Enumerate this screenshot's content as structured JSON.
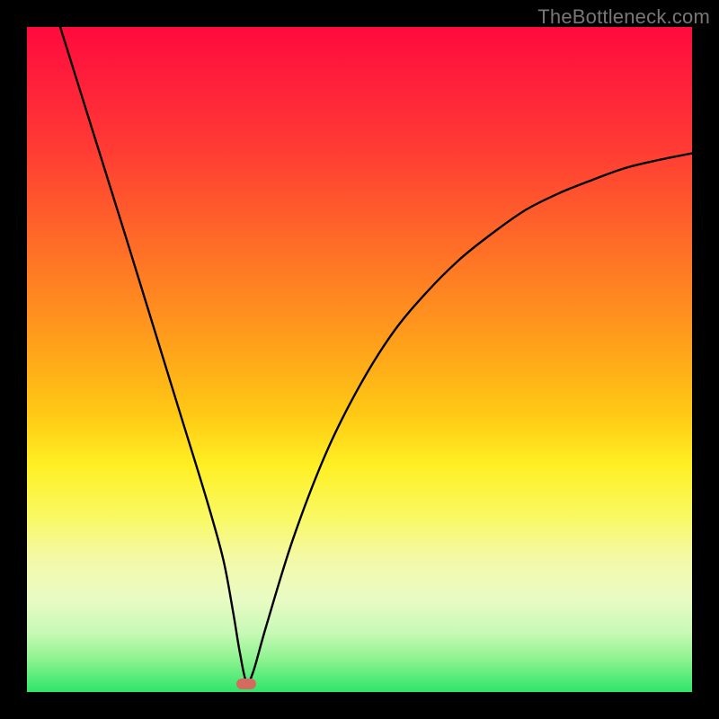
{
  "attribution": "TheBottleneck.com",
  "colors": {
    "bg": "#000000",
    "top": "#ff0a3c",
    "bottom": "#2de56a",
    "curve": "#000000",
    "dot": "#d66a60"
  },
  "chart_data": {
    "type": "line",
    "title": "",
    "xlabel": "",
    "ylabel": "",
    "xlim": [
      0,
      100
    ],
    "ylim": [
      0,
      100
    ],
    "grid": false,
    "legend": false,
    "series": [
      {
        "name": "bottleneck-curve",
        "x": [
          5,
          10,
          15,
          19,
          23,
          27,
          29.5,
          31,
          32,
          33,
          34,
          36,
          40,
          45,
          50,
          55,
          60,
          65,
          70,
          75,
          80,
          85,
          90,
          95,
          100
        ],
        "y": [
          100,
          84,
          68,
          55,
          42,
          29,
          20,
          12,
          6,
          1.5,
          3,
          10,
          23,
          36,
          46,
          54,
          60,
          65,
          69,
          72.5,
          75,
          77,
          78.8,
          80,
          81
        ]
      }
    ],
    "marker": {
      "x": 33,
      "y_pct_from_top": 98.8
    }
  }
}
